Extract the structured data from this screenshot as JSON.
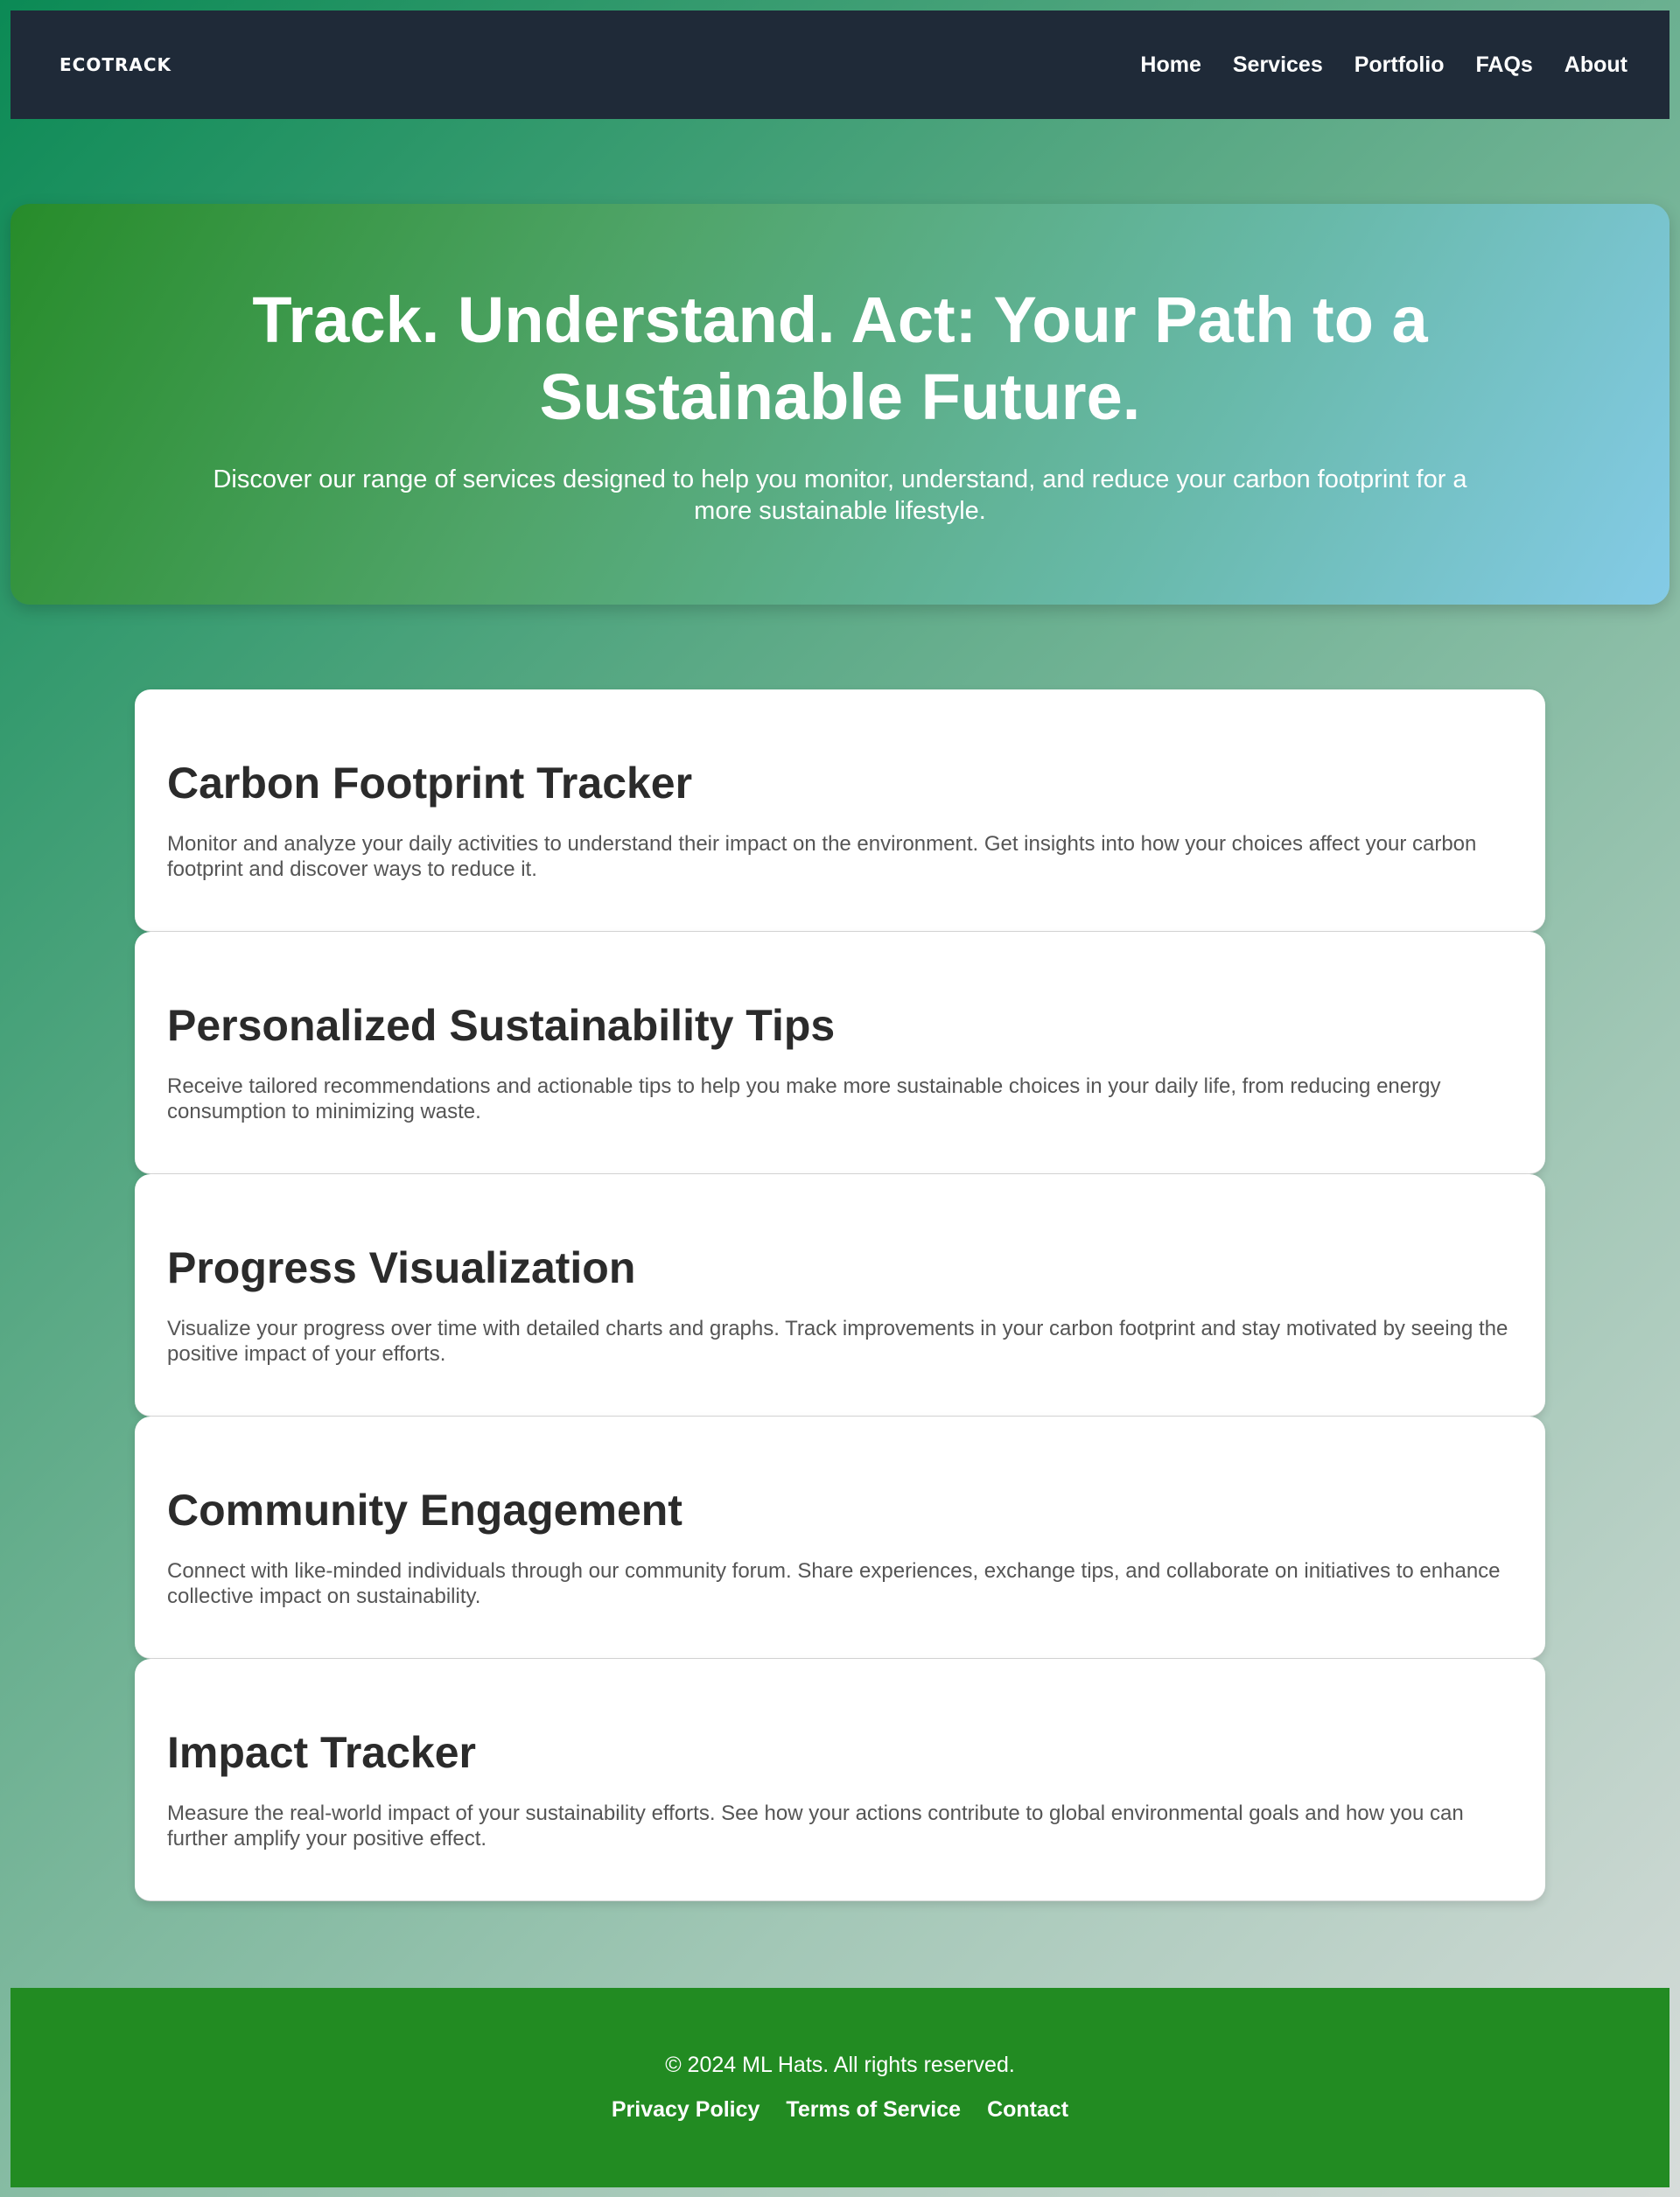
{
  "header": {
    "brand": "ECOTRACK",
    "nav": [
      "Home",
      "Services",
      "Portfolio",
      "FAQs",
      "About"
    ]
  },
  "hero": {
    "title": "Track. Understand. Act: Your Path to a Sustainable Future.",
    "subtitle": "Discover our range of services designed to help you monitor, understand, and reduce your carbon footprint for a more sustainable lifestyle."
  },
  "services": [
    {
      "title": "Carbon Footprint Tracker",
      "description": "Monitor and analyze your daily activities to understand their impact on the environment. Get insights into how your choices affect your carbon footprint and discover ways to reduce it."
    },
    {
      "title": "Personalized Sustainability Tips",
      "description": "Receive tailored recommendations and actionable tips to help you make more sustainable choices in your daily life, from reducing energy consumption to minimizing waste."
    },
    {
      "title": "Progress Visualization",
      "description": "Visualize your progress over time with detailed charts and graphs. Track improvements in your carbon footprint and stay motivated by seeing the positive impact of your efforts."
    },
    {
      "title": "Community Engagement",
      "description": "Connect with like-minded individuals through our community forum. Share experiences, exchange tips, and collaborate on initiatives to enhance collective impact on sustainability."
    },
    {
      "title": "Impact Tracker",
      "description": "Measure the real-world impact of your sustainability efforts. See how your actions contribute to global environmental goals and how you can further amplify your positive effect."
    }
  ],
  "footer": {
    "copyright": "© 2024 ML Hats. All rights reserved.",
    "links": [
      "Privacy Policy",
      "Terms of Service",
      "Contact"
    ]
  },
  "colors": {
    "navbar": "#1f2a38",
    "footer": "#228b22",
    "hero_start": "#278c2a",
    "hero_end": "#84cbe7"
  }
}
